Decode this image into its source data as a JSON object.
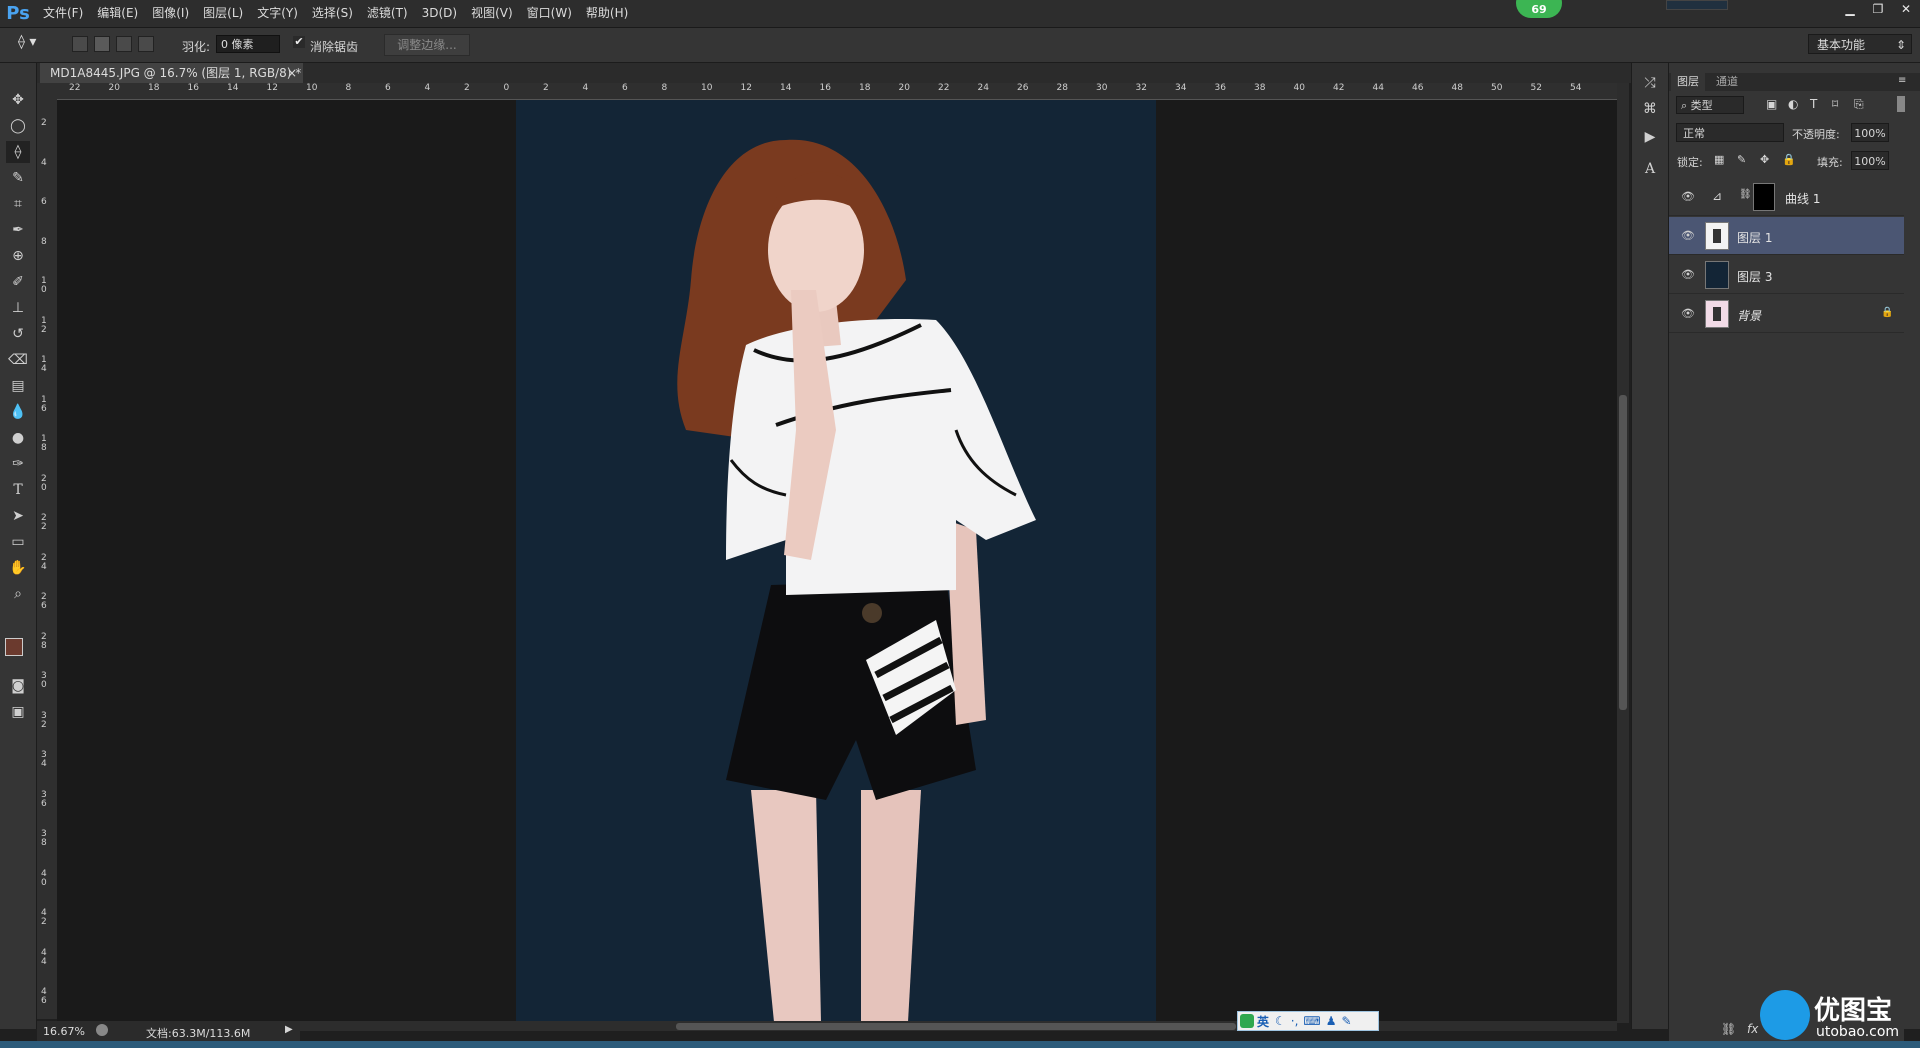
{
  "app": {
    "logo": "Ps"
  },
  "menu": [
    "文件(F)",
    "编辑(E)",
    "图像(I)",
    "图层(L)",
    "文字(Y)",
    "选择(S)",
    "滤镜(T)",
    "3D(D)",
    "视图(V)",
    "窗口(W)",
    "帮助(H)"
  ],
  "badge": "69",
  "options": {
    "feather_label": "羽化:",
    "feather_value": "0 像素",
    "antialias_label": "消除锯齿",
    "antialias_checked": "✔",
    "refine_edge": "调整边缘...",
    "workspace": "基本功能"
  },
  "document": {
    "tab_title": "MD1A8445.JPG @ 16.7% (图层 1, RGB/8) *",
    "close": "×",
    "zoom": "16.67%",
    "doc_size": "文档:63.3M/113.6M",
    "background_color": "#132536"
  },
  "ruler_h": [
    "22",
    "20",
    "18",
    "16",
    "14",
    "12",
    "10",
    "8",
    "6",
    "4",
    "2",
    "0",
    "2",
    "4",
    "6",
    "8",
    "10",
    "12",
    "14",
    "16",
    "18",
    "20",
    "22",
    "24",
    "26",
    "28",
    "30",
    "32",
    "34",
    "36",
    "38",
    "40",
    "42",
    "44",
    "46",
    "48",
    "50",
    "52",
    "54"
  ],
  "ruler_v": [
    "2",
    "4",
    "6",
    "8",
    "10",
    "12",
    "14",
    "16",
    "18",
    "20",
    "22",
    "24",
    "26",
    "28",
    "30",
    "32",
    "34",
    "36",
    "38",
    "40",
    "42",
    "44",
    "46"
  ],
  "layers_panel": {
    "tabs": [
      "图层",
      "通道"
    ],
    "kind": "类型",
    "blend_mode": "正常",
    "opacity_label": "不透明度:",
    "opacity": "100%",
    "lock_label": "锁定:",
    "fill_label": "填充:",
    "fill": "100%",
    "layers": [
      {
        "name": "曲线 1",
        "type": "adjustment",
        "visible": true,
        "selected": false
      },
      {
        "name": "图层 1",
        "type": "pixel",
        "visible": true,
        "selected": true
      },
      {
        "name": "图层 3",
        "type": "pixel",
        "visible": true,
        "selected": false
      },
      {
        "name": "背景",
        "type": "background",
        "visible": true,
        "selected": false,
        "locked": true
      }
    ]
  },
  "ime": {
    "label": "英"
  },
  "watermark": {
    "name": "优图宝",
    "url": "utobao.com"
  },
  "colors": {
    "accent": "#4aa3f0",
    "selected_layer": "#4b5673",
    "foreground": "#6b3a2e",
    "background": "#f2d9e8"
  }
}
